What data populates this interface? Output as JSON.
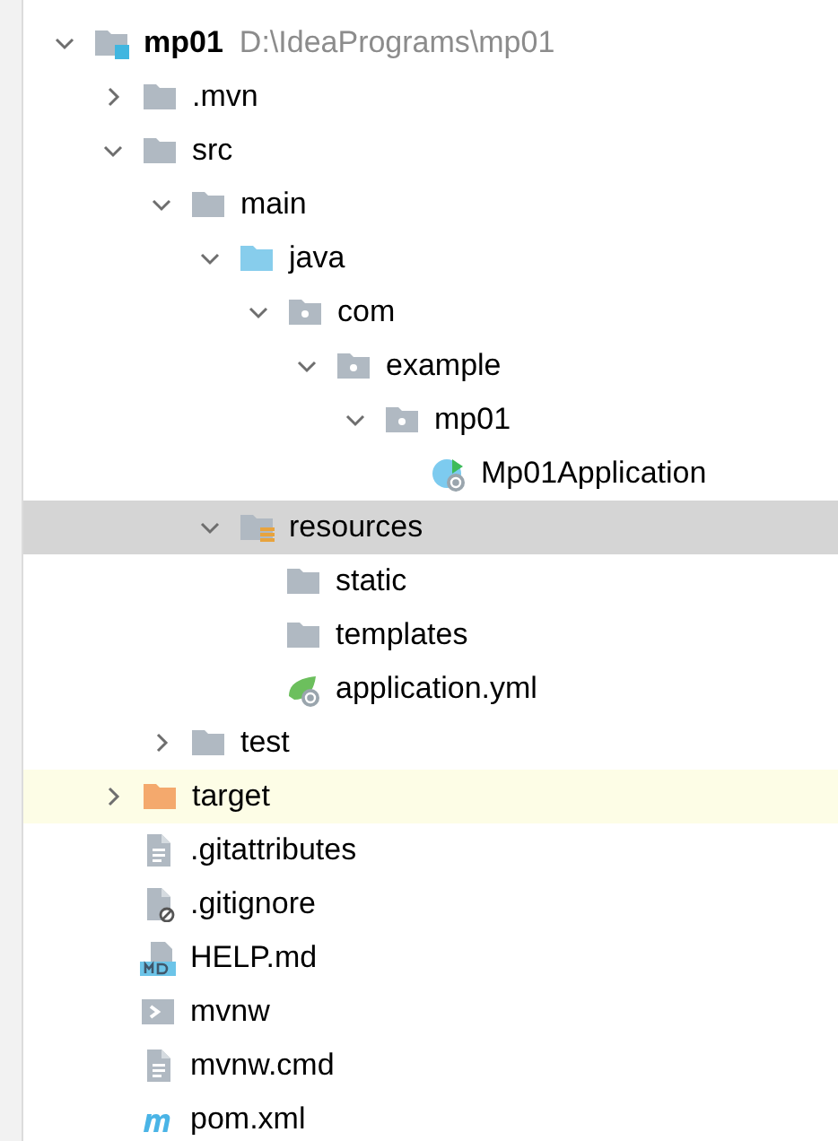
{
  "tree": [
    {
      "label": "mp01",
      "path": "D:\\IdeaPrograms\\mp01",
      "kind": "project",
      "expanded": true,
      "selected": false,
      "excluded": false,
      "children": [
        {
          "label": ".mvn",
          "kind": "folder",
          "expanded": false,
          "selected": false,
          "excluded": false
        },
        {
          "label": "src",
          "kind": "folder",
          "expanded": true,
          "selected": false,
          "excluded": false,
          "children": [
            {
              "label": "main",
              "kind": "folder",
              "expanded": true,
              "selected": false,
              "excluded": false,
              "children": [
                {
                  "label": "java",
                  "kind": "source",
                  "expanded": true,
                  "selected": false,
                  "excluded": false,
                  "children": [
                    {
                      "label": "com",
                      "kind": "package",
                      "expanded": true,
                      "selected": false,
                      "excluded": false,
                      "children": [
                        {
                          "label": "example",
                          "kind": "package",
                          "expanded": true,
                          "selected": false,
                          "excluded": false,
                          "children": [
                            {
                              "label": "mp01",
                              "kind": "package",
                              "expanded": true,
                              "selected": false,
                              "excluded": false,
                              "children": [
                                {
                                  "label": "Mp01Application",
                                  "kind": "spring-class",
                                  "selected": false,
                                  "excluded": false
                                }
                              ]
                            }
                          ]
                        }
                      ]
                    }
                  ]
                },
                {
                  "label": "resources",
                  "kind": "resources",
                  "expanded": true,
                  "selected": true,
                  "children": [
                    {
                      "label": "static",
                      "kind": "folder",
                      "selected": false,
                      "excluded": false
                    },
                    {
                      "label": "templates",
                      "kind": "folder",
                      "selected": false,
                      "excluded": false
                    },
                    {
                      "label": "application.yml",
                      "kind": "spring-config",
                      "selected": false,
                      "excluded": false
                    }
                  ]
                }
              ]
            },
            {
              "label": "test",
              "kind": "folder",
              "expanded": false,
              "selected": false,
              "excluded": false
            }
          ]
        },
        {
          "label": "target",
          "kind": "excluded-folder",
          "expanded": false,
          "selected": false,
          "excluded": true
        },
        {
          "label": ".gitattributes",
          "kind": "text-file",
          "selected": false,
          "excluded": false
        },
        {
          "label": ".gitignore",
          "kind": "ignore-file",
          "selected": false,
          "excluded": false
        },
        {
          "label": "HELP.md",
          "kind": "markdown",
          "selected": false,
          "excluded": false
        },
        {
          "label": "mvnw",
          "kind": "shell",
          "selected": false,
          "excluded": false
        },
        {
          "label": "mvnw.cmd",
          "kind": "text-file",
          "selected": false,
          "excluded": false
        },
        {
          "label": "pom.xml",
          "kind": "maven",
          "selected": false,
          "excluded": false
        }
      ]
    }
  ]
}
